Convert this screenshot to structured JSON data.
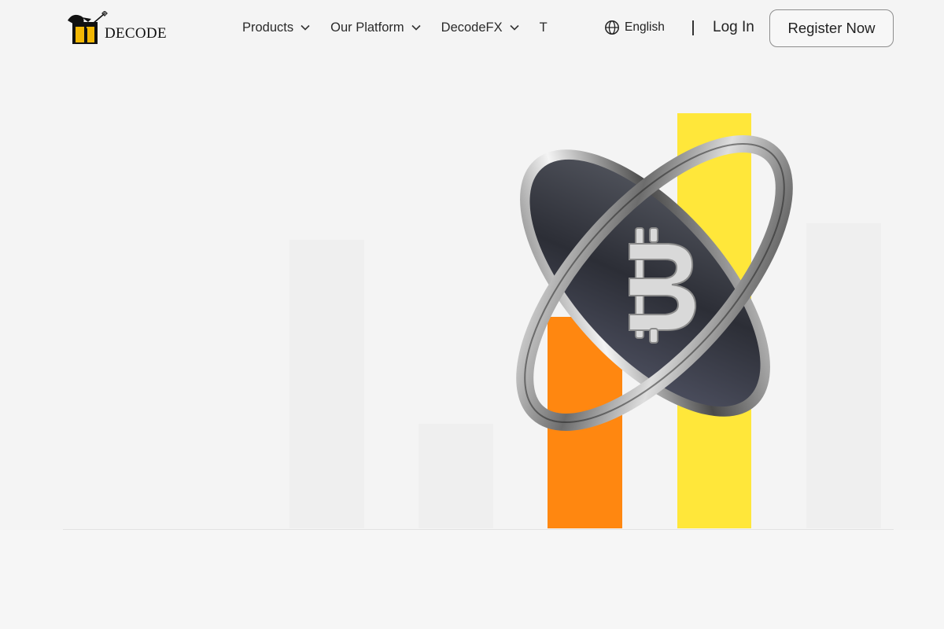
{
  "header": {
    "logo_text": "DECODE",
    "nav": [
      {
        "label": "Products",
        "icon": "chevron-down-icon"
      },
      {
        "label": "Our Platform",
        "icon": "chevron-down-icon"
      },
      {
        "label": "DecodeFX",
        "icon": "chevron-down-icon"
      },
      {
        "label": "T"
      }
    ],
    "language": {
      "label": "English",
      "icon": "globe-icon"
    },
    "login_label": "Log In",
    "register_label": "Register Now"
  },
  "hero": {
    "illustration": "coin-with-rings",
    "bars": [
      {
        "name": "bar-1",
        "color": "#efefef"
      },
      {
        "name": "bar-2",
        "color": "#efefef"
      },
      {
        "name": "bar-3-orange",
        "color": "#ff8710"
      },
      {
        "name": "bar-4-yellow",
        "color": "#ffe73a"
      },
      {
        "name": "bar-5",
        "color": "#efefef"
      }
    ]
  },
  "colors": {
    "background": "#f4f4f4",
    "accent_orange": "#ff8710",
    "accent_yellow": "#ffe73a"
  }
}
